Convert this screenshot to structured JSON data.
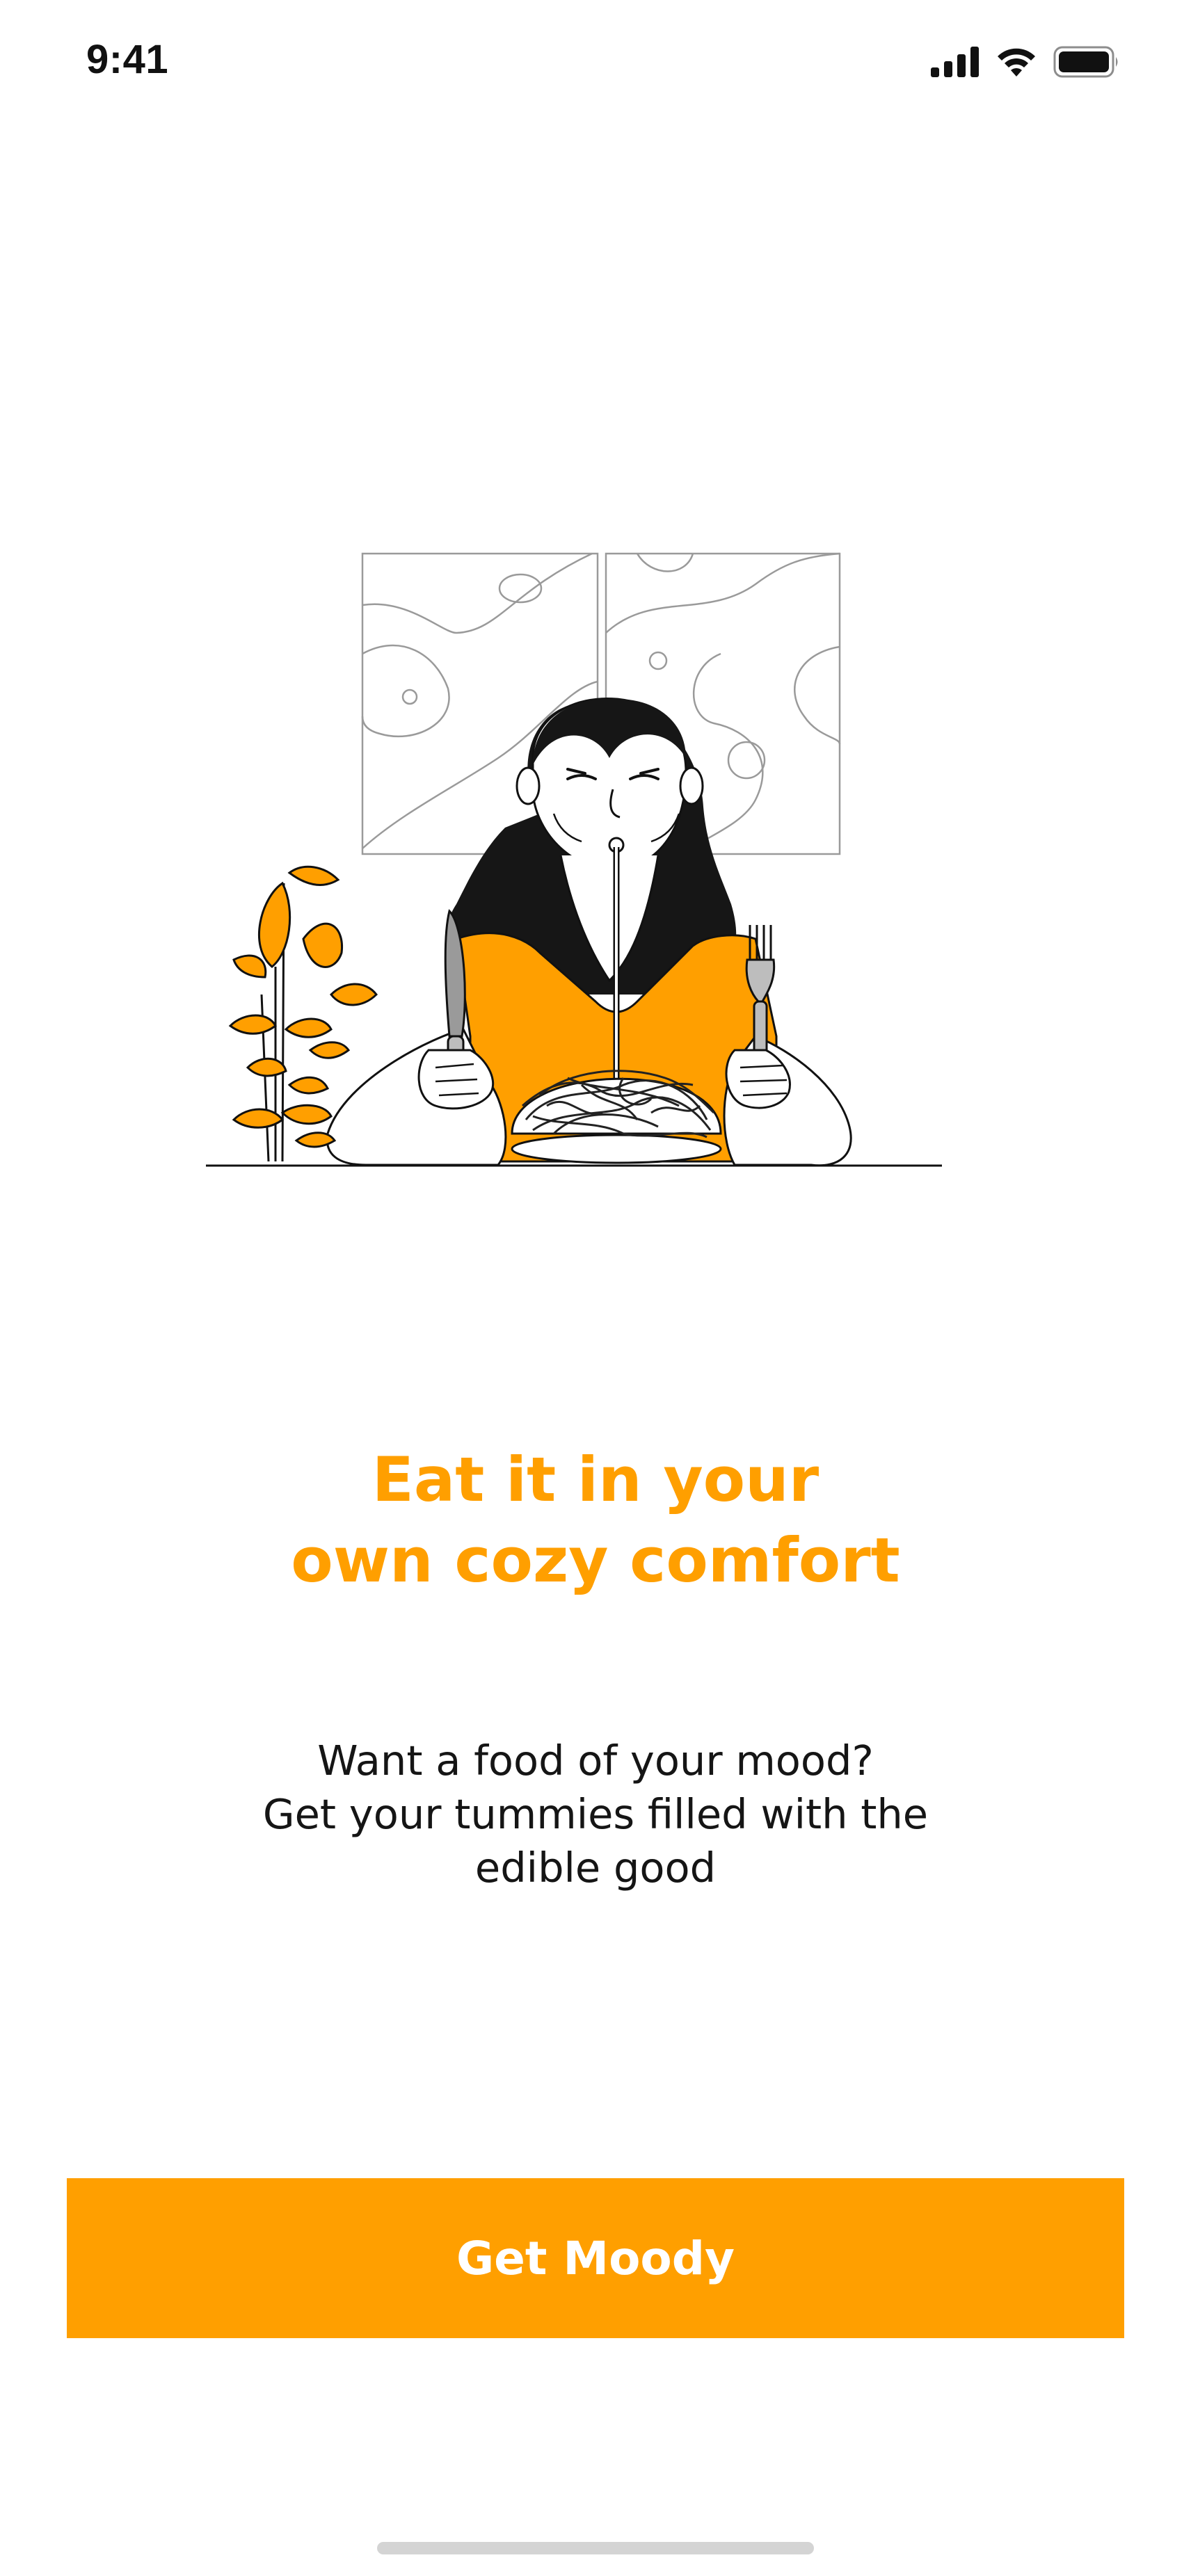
{
  "status_bar": {
    "time": "9:41",
    "icons": [
      "cellular-signal-icon",
      "wifi-icon",
      "battery-icon"
    ]
  },
  "illustration": {
    "subject": "woman-eating-spaghetti-illustration"
  },
  "onboarding": {
    "headline_line1": "Eat it in your",
    "headline_line2": "own cozy comfort",
    "subtitle_line1": "Want a food of your mood?",
    "subtitle_line2": "Get your tummies filled with the",
    "subtitle_line3": "edible good",
    "cta_label": "Get Moody"
  },
  "colors": {
    "accent": "#ff9f00",
    "text": "#151515",
    "background": "#ffffff",
    "home_indicator": "#d4d4d4"
  }
}
